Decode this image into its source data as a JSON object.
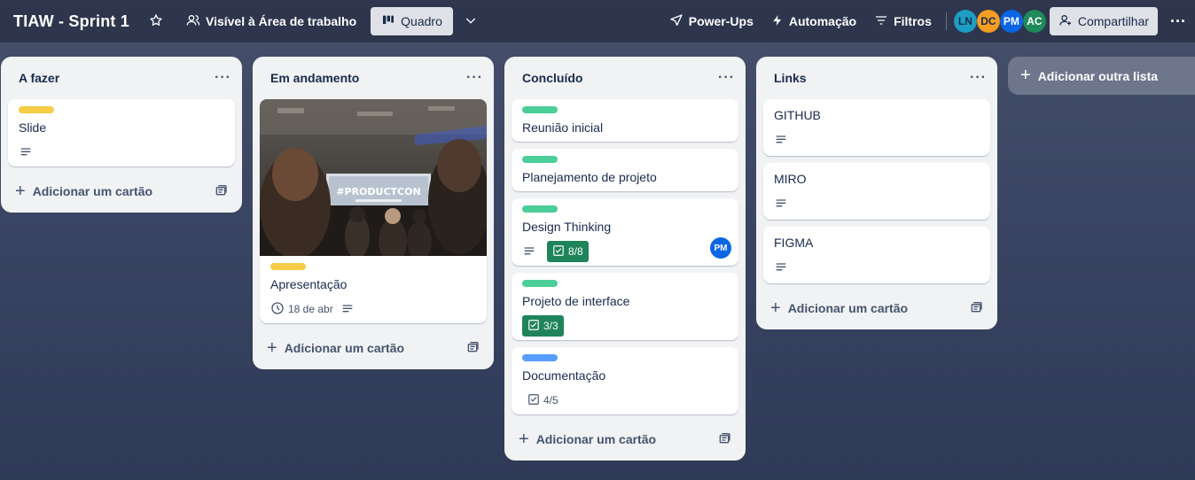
{
  "header": {
    "board_title": "TIAW - Sprint 1",
    "visibility_label": "Visível à Área de trabalho",
    "view_label": "Quadro",
    "powerups_label": "Power-Ups",
    "automation_label": "Automação",
    "filters_label": "Filtros",
    "share_label": "Compartilhar",
    "members": [
      {
        "initials": "LN",
        "color": "#1d9fc4"
      },
      {
        "initials": "DC",
        "color": "#f59e23"
      },
      {
        "initials": "PM",
        "color": "#0c66e4"
      },
      {
        "initials": "AC",
        "color": "#1f8a5a"
      }
    ]
  },
  "add_card_label": "Adicionar um cartão",
  "add_list_label": "Adicionar outra lista",
  "colors": {
    "label_yellow": "#f5cd47",
    "label_green": "#4bce97",
    "label_blue": "#579dff",
    "check_complete": "#1f845a"
  },
  "lists": [
    {
      "title": "A fazer",
      "cards": [
        {
          "title": "Slide",
          "label_color": "yellow",
          "has_description": true
        }
      ]
    },
    {
      "title": "Em andamento",
      "cards": [
        {
          "title": "Apresentação",
          "label_color": "yellow",
          "cover_text": "#PRODUCTCON",
          "due_date": "18 de abr",
          "has_description": true
        }
      ]
    },
    {
      "title": "Concluído",
      "cards": [
        {
          "title": "Reunião inicial",
          "label_color": "green"
        },
        {
          "title": "Planejamento de projeto",
          "label_color": "green"
        },
        {
          "title": "Design Thinking",
          "label_color": "green",
          "has_description": true,
          "checklist": "8/8",
          "member": "PM"
        },
        {
          "title": "Projeto de interface",
          "label_color": "green",
          "checklist": "3/3"
        },
        {
          "title": "Documentação",
          "label_color": "blue",
          "checklist": "4/5"
        }
      ]
    },
    {
      "title": "Links",
      "cards": [
        {
          "title": "GITHUB",
          "has_description": true
        },
        {
          "title": "MIRO",
          "has_description": true
        },
        {
          "title": "FIGMA",
          "has_description": true
        }
      ]
    }
  ]
}
